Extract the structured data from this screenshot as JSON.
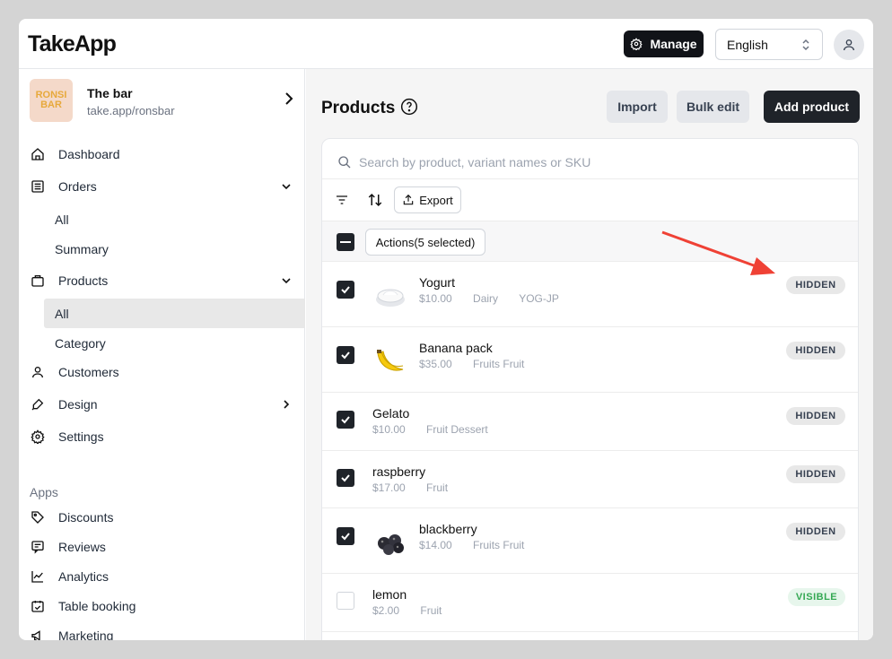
{
  "app": {
    "logo": "TakeApp"
  },
  "header": {
    "manage_label": "Manage",
    "language": "English"
  },
  "store": {
    "logo_text": "RONSI BAR",
    "name": "The bar",
    "url": "take.app/ronsbar"
  },
  "sidebar": {
    "dashboard": "Dashboard",
    "orders": "Orders",
    "orders_all": "All",
    "orders_summary": "Summary",
    "products": "Products",
    "products_all": "All",
    "products_category": "Category",
    "customers": "Customers",
    "design": "Design",
    "settings": "Settings",
    "apps_title": "Apps",
    "discounts": "Discounts",
    "reviews": "Reviews",
    "analytics": "Analytics",
    "table_booking": "Table booking",
    "marketing": "Marketing"
  },
  "main": {
    "title": "Products",
    "import_label": "Import",
    "bulk_edit_label": "Bulk edit",
    "add_label": "Add product",
    "search_placeholder": "Search by product, variant names or SKU",
    "export_label": "Export",
    "actions_label": "Actions(5 selected)"
  },
  "products": [
    {
      "name": "Yogurt",
      "price": "$10.00",
      "category": "Dairy",
      "sku": "YOG-JP",
      "status": "HIDDEN",
      "checked": true,
      "image": "yogurt-bowl"
    },
    {
      "name": "Banana pack",
      "price": "$35.00",
      "category": "Fruits Fruit",
      "sku": "",
      "status": "HIDDEN",
      "checked": true,
      "image": "banana"
    },
    {
      "name": "Gelato",
      "price": "$10.00",
      "category": "Fruit Dessert",
      "sku": "",
      "status": "HIDDEN",
      "checked": true,
      "image": ""
    },
    {
      "name": "raspberry",
      "price": "$17.00",
      "category": "Fruit",
      "sku": "",
      "status": "HIDDEN",
      "checked": true,
      "image": ""
    },
    {
      "name": "blackberry",
      "price": "$14.00",
      "category": "Fruits Fruit",
      "sku": "",
      "status": "HIDDEN",
      "checked": true,
      "image": "blackberry"
    },
    {
      "name": "lemon",
      "price": "$2.00",
      "category": "Fruit",
      "sku": "",
      "status": "VISIBLE",
      "checked": false,
      "image": ""
    }
  ],
  "colors": {
    "dark": "#1f2329",
    "visible_green": "#34a853",
    "annotation_arrow": "#ef4135"
  }
}
